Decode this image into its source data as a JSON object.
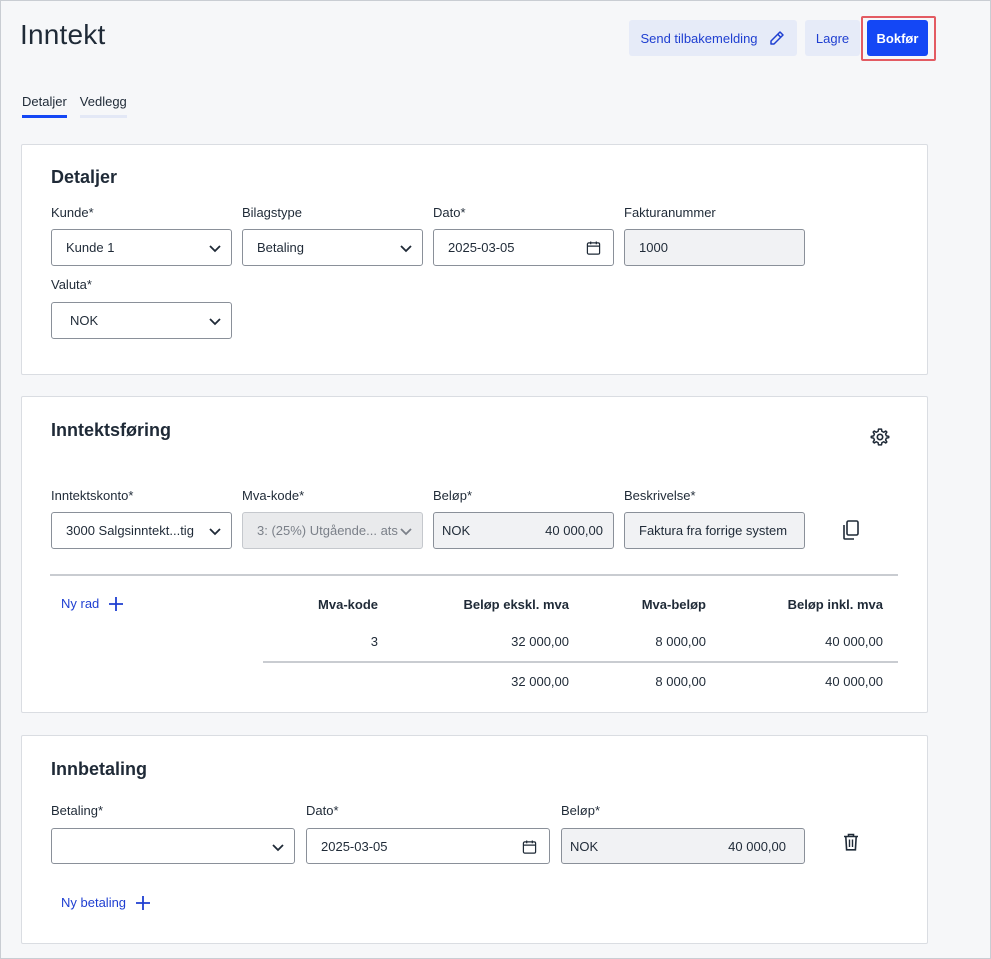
{
  "header": {
    "title": "Inntekt",
    "send_label": "Send tilbakemelding",
    "save_label": "Lagre",
    "post_label": "Bokfør"
  },
  "tabs": [
    {
      "label": "Detaljer",
      "active": true
    },
    {
      "label": "Vedlegg",
      "active": false
    }
  ],
  "details": {
    "title": "Detaljer",
    "customer_label": "Kunde*",
    "customer_value": "Kunde 1",
    "voucher_type_label": "Bilagstype",
    "voucher_type_value": "Betaling",
    "date_label": "Dato*",
    "date_value": "2025-03-05",
    "invoice_label": "Fakturanummer",
    "invoice_value": "1000",
    "currency_label": "Valuta*",
    "currency_value": "NOK"
  },
  "income": {
    "title": "Inntektsføring",
    "account_label": "Inntektskonto*",
    "account_value": "3000 Salgsinntekt...tig",
    "vat_label": "Mva-kode*",
    "vat_value": "3: (25%) Utgående... ats",
    "amount_label": "Beløp*",
    "amount_currency": "NOK",
    "amount_value": "40 000,00",
    "desc_label": "Beskrivelse*",
    "desc_value": "Faktura fra forrige system",
    "new_row_label": "Ny rad",
    "summary": {
      "headers": [
        "Mva-kode",
        "Beløp ekskl. mva",
        "Mva-beløp",
        "Beløp inkl. mva"
      ],
      "row": [
        "3",
        "32 000,00",
        "8 000,00",
        "40 000,00"
      ],
      "total": [
        "32 000,00",
        "8 000,00",
        "40 000,00"
      ]
    }
  },
  "payment": {
    "title": "Innbetaling",
    "payment_label": "Betaling*",
    "payment_value": "",
    "date_label": "Dato*",
    "date_value": "2025-03-05",
    "amount_label": "Beløp*",
    "amount_currency": "NOK",
    "amount_value": "40 000,00",
    "new_payment_label": "Ny betaling"
  },
  "colors": {
    "primary": "#1447f5",
    "secondary_bg": "#e6ebf8",
    "highlight": "#e35b62"
  }
}
